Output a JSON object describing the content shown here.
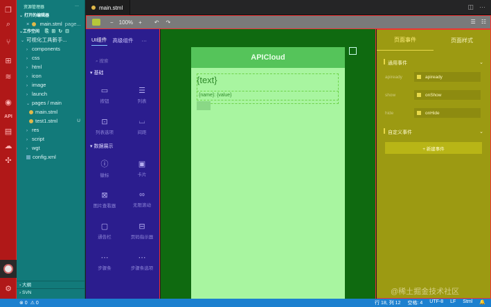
{
  "activity_bar": {
    "items": [
      {
        "name": "explorer-icon",
        "glyph": "❐"
      },
      {
        "name": "search-icon",
        "glyph": "⌕"
      },
      {
        "name": "source-control-icon",
        "glyph": "⑂"
      },
      {
        "name": "extensions-icon",
        "glyph": "⊞"
      },
      {
        "name": "stack-icon",
        "glyph": "≋"
      },
      {
        "name": "preview-icon",
        "glyph": "◉"
      },
      {
        "name": "api-label",
        "glyph": "API"
      },
      {
        "name": "book-icon",
        "glyph": "▤"
      },
      {
        "name": "cloud-icon",
        "glyph": "☁"
      },
      {
        "name": "plugin-icon",
        "glyph": "✣"
      }
    ],
    "settings_glyph": "⚙"
  },
  "explorer": {
    "title": "资源管理器",
    "menu": "···",
    "open_editors_label": "打开的编辑器",
    "open_editor_file": "main.stml",
    "open_editor_path": "page...",
    "workspace_label": "工作空间",
    "project_name": "可视化工具新手...",
    "tree": [
      {
        "label": "components",
        "type": "folder",
        "depth": 1
      },
      {
        "label": "css",
        "type": "folder",
        "depth": 1
      },
      {
        "label": "html",
        "type": "folder",
        "depth": 1
      },
      {
        "label": "icon",
        "type": "folder",
        "depth": 1
      },
      {
        "label": "image",
        "type": "folder",
        "depth": 1
      },
      {
        "label": "launch",
        "type": "folder",
        "depth": 1
      },
      {
        "label": "pages / main",
        "type": "folder-open",
        "depth": 1
      },
      {
        "label": "main.stml",
        "type": "stml",
        "depth": 2,
        "badge": ""
      },
      {
        "label": "test1.stml",
        "type": "stml",
        "depth": 2,
        "badge": "U"
      },
      {
        "label": "res",
        "type": "folder",
        "depth": 1
      },
      {
        "label": "script",
        "type": "folder",
        "depth": 1
      },
      {
        "label": "wgt",
        "type": "folder",
        "depth": 1
      },
      {
        "label": "config.xml",
        "type": "xml",
        "depth": 1
      }
    ],
    "outline_label": "大纲",
    "svn_label": "SVN"
  },
  "editor": {
    "tab_label": "main.stml"
  },
  "toolbar": {
    "zoom_out": "−",
    "zoom": "100%",
    "zoom_in": "+",
    "undo": "↶",
    "redo": "↷"
  },
  "components_panel": {
    "tab_ui": "UI组件",
    "tab_advanced": "高级组件",
    "menu": "···",
    "search_placeholder": "搜索",
    "category_basic": "基础",
    "basic_items": [
      {
        "label": "按钮",
        "icon": "▭"
      },
      {
        "label": "列表",
        "icon": "☰"
      },
      {
        "label": "列表选项",
        "icon": "⊡"
      },
      {
        "label": "间距",
        "icon": "⌴"
      }
    ],
    "category_display": "数据展示",
    "display_items": [
      {
        "label": "徽标",
        "icon": "ⓘ"
      },
      {
        "label": "卡片",
        "icon": "▣"
      },
      {
        "label": "图片查看器",
        "icon": "⊠"
      },
      {
        "label": "无限滚动",
        "icon": "∞"
      },
      {
        "label": "通告栏",
        "icon": "▢"
      },
      {
        "label": "页码指示器",
        "icon": "⊟"
      },
      {
        "label": "步骤条",
        "icon": "⋯"
      },
      {
        "label": "步骤条选项",
        "icon": "⋯"
      }
    ]
  },
  "canvas": {
    "nav_title": "APICloud",
    "text_placeholder": "{text}",
    "name_value": "{name}: {value}"
  },
  "properties": {
    "tab_page_events": "页面事件",
    "tab_page_style": "页面样式",
    "common_events_label": "通用事件",
    "events": [
      {
        "label": "apiready",
        "value": "apiready"
      },
      {
        "label": "show",
        "value": "onShow"
      },
      {
        "label": "hide",
        "value": "onHide"
      }
    ],
    "custom_events_label": "自定义事件",
    "new_event_label": "+ 新建事件",
    "watermark": "@稀土掘金技术社区"
  },
  "statusbar": {
    "errors": "⊗ 0",
    "warnings": "⚠ 0",
    "position": "行 18, 列 12",
    "indent": "空格: 4",
    "encoding": "UTF-8",
    "eol": "LF",
    "language": "Stml",
    "bell": "🔔"
  }
}
